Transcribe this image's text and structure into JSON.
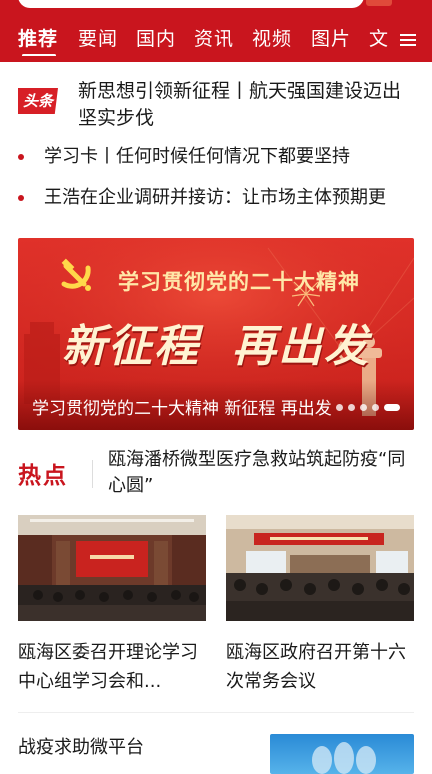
{
  "tabs": [
    {
      "label": "推荐",
      "active": true
    },
    {
      "label": "要闻"
    },
    {
      "label": "国内"
    },
    {
      "label": "资讯"
    },
    {
      "label": "视频"
    },
    {
      "label": "图片"
    },
    {
      "label": "文"
    }
  ],
  "menu_icon": "hamburger-menu-icon",
  "headline": {
    "badge": "头条",
    "title": "新思想引领新征程丨航天强国建设迈出坚实步伐"
  },
  "news": [
    "学习卡丨任何时候任何情况下都要坚持",
    "王浩在企业调研并接访：让市场主体预期更"
  ],
  "banner": {
    "subtitle": "学习贯彻党的二十大精神",
    "big_left": "新征程",
    "big_right": "再出发",
    "caption": "学习贯彻党的二十大精神 新征程 再出发"
  },
  "hot": {
    "label": "热点",
    "text": "瓯海潘桥微型医疗急救站筑起防疫“同心圆”"
  },
  "cards": [
    {
      "title": "瓯海区委召开理论学习中心组学习会和..."
    },
    {
      "title": "瓯海区政府召开第十六次常务会议"
    }
  ],
  "bottom": {
    "title": "战疫求助微平台"
  },
  "colors": {
    "brand_red": "#c9151e",
    "badge_red": "#d71f26",
    "banner_red": "#d72a24"
  }
}
